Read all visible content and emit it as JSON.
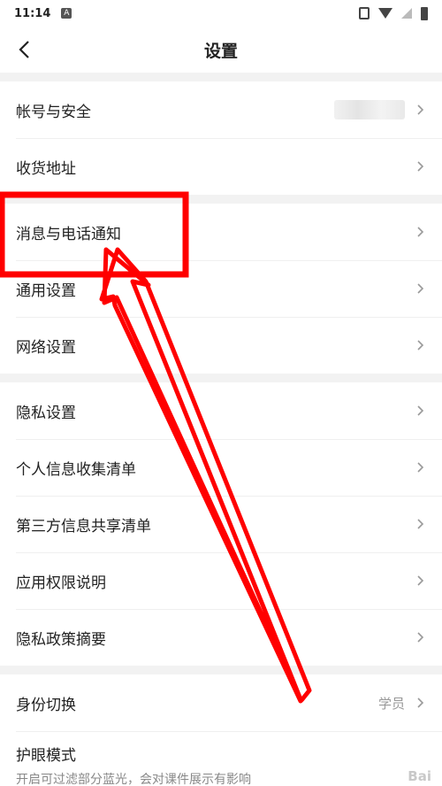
{
  "status_bar": {
    "time": "11:14",
    "badge": "A"
  },
  "header": {
    "title": "设置"
  },
  "groups": [
    {
      "items": [
        {
          "label": "帐号与安全"
        },
        {
          "label": "收货地址"
        }
      ]
    },
    {
      "items": [
        {
          "label": "消息与电话通知"
        },
        {
          "label": "通用设置"
        },
        {
          "label": "网络设置"
        }
      ]
    },
    {
      "items": [
        {
          "label": "隐私设置"
        },
        {
          "label": "个人信息收集清单"
        },
        {
          "label": "第三方信息共享清单"
        },
        {
          "label": "应用权限说明"
        },
        {
          "label": "隐私政策摘要"
        }
      ]
    },
    {
      "items": [
        {
          "label": "身份切换",
          "value": "学员"
        },
        {
          "label": "护眼模式",
          "subtitle": "开启可过滤部分蓝光，会对课件展示有影响"
        }
      ]
    }
  ],
  "annotation_color": "#ff0000",
  "watermark": "Bai"
}
